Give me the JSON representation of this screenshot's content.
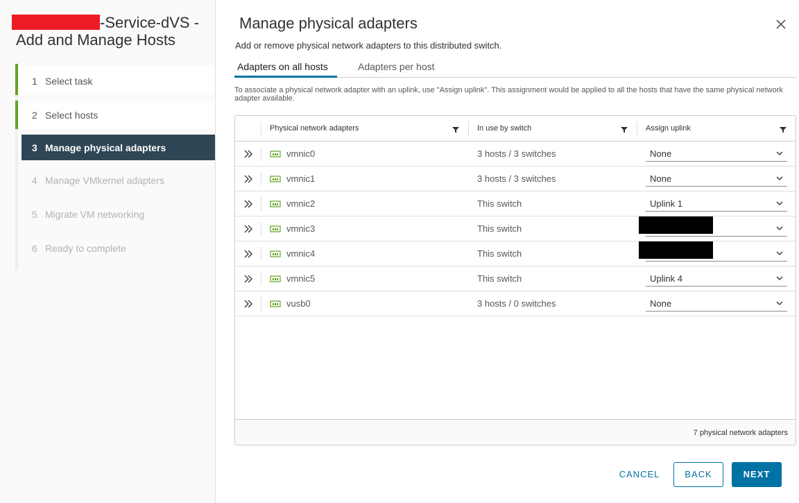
{
  "wizard": {
    "title_suffix": "-Service-dVS -",
    "title_line2": "Add and Manage Hosts",
    "steps": [
      {
        "num": "1",
        "label": "Select task",
        "state": "done"
      },
      {
        "num": "2",
        "label": "Select hosts",
        "state": "done"
      },
      {
        "num": "3",
        "label": "Manage physical adapters",
        "state": "active"
      },
      {
        "num": "4",
        "label": "Manage VMkernel adapters",
        "state": "todo"
      },
      {
        "num": "5",
        "label": "Migrate VM networking",
        "state": "todo"
      },
      {
        "num": "6",
        "label": "Ready to complete",
        "state": "todo"
      }
    ]
  },
  "page": {
    "title": "Manage physical adapters",
    "subtitle": "Add or remove physical network adapters to this distributed switch.",
    "tabs": [
      {
        "label": "Adapters on all hosts",
        "active": true
      },
      {
        "label": "Adapters per host",
        "active": false
      }
    ],
    "hint": "To associate a physical network adapter with an uplink, use \"Assign uplink\". This assignment would be applied to all the hosts that have the same physical network adapter available."
  },
  "grid": {
    "columns": [
      "Physical network adapters",
      "In use by switch",
      "Assign uplink"
    ],
    "rows": [
      {
        "name": "vmnic0",
        "in_use": "3 hosts / 3 switches",
        "uplink": "None",
        "redacted": false
      },
      {
        "name": "vmnic1",
        "in_use": "3 hosts / 3 switches",
        "uplink": "None",
        "redacted": false
      },
      {
        "name": "vmnic2",
        "in_use": "This switch",
        "uplink": "Uplink 1",
        "redacted": false
      },
      {
        "name": "vmnic3",
        "in_use": "This switch",
        "uplink": "",
        "redacted": true
      },
      {
        "name": "vmnic4",
        "in_use": "This switch",
        "uplink": "",
        "redacted": true
      },
      {
        "name": "vmnic5",
        "in_use": "This switch",
        "uplink": "Uplink 4",
        "redacted": false
      },
      {
        "name": "vusb0",
        "in_use": "3 hosts / 0 switches",
        "uplink": "None",
        "redacted": false
      }
    ],
    "footer": "7 physical network adapters"
  },
  "buttons": {
    "cancel": "CANCEL",
    "back": "BACK",
    "next": "NEXT"
  },
  "colors": {
    "accent": "#0072a3",
    "step_done": "#62a420",
    "step_active_bg": "#2f4656",
    "redaction_red": "#ed1c24",
    "nic_icon": "#62a420"
  },
  "icons": {
    "close": "close-icon",
    "filter": "filter-icon",
    "expand": "double-chevron-right-icon",
    "nic": "network-adapter-icon",
    "dropdown": "chevron-down-icon"
  }
}
